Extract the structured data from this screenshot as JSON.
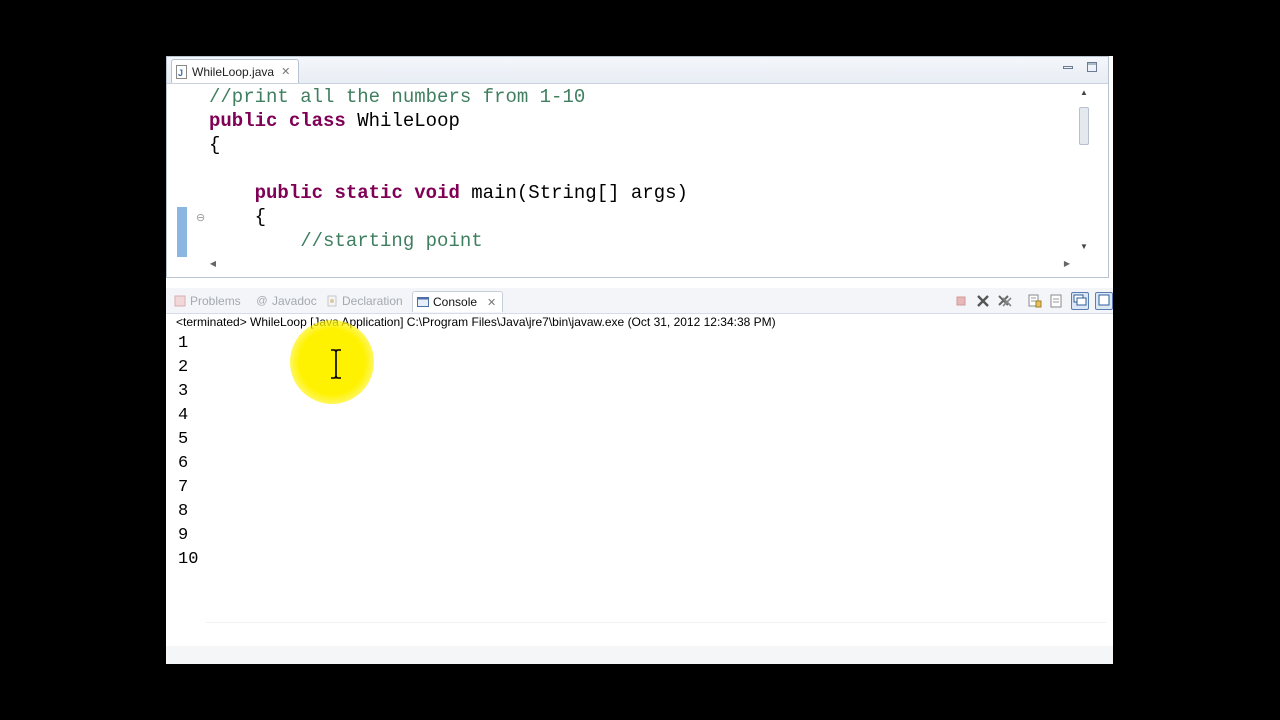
{
  "editor": {
    "tab_title": "WhileLoop.java",
    "close_glyph": "✕",
    "minimize_glyph": "▭",
    "maximize_glyph": "□",
    "code": {
      "line1_comment": "//print all the numbers from 1-10",
      "line2_kw1": "public",
      "line2_kw2": "class",
      "line2_name": "WhileLoop",
      "line3": "{",
      "line5_kw1": "public",
      "line5_kw2": "static",
      "line5_kw3": "void",
      "line5_rest": "main(String[] args)",
      "line6": "{",
      "line7_comment": "//starting point"
    }
  },
  "views": {
    "tabs": {
      "problems": "Problems",
      "javadoc": "Javadoc",
      "declaration": "Declaration",
      "console": "Console"
    },
    "console_close_glyph": "✕",
    "status": "<terminated> WhileLoop [Java Application] C:\\Program Files\\Java\\jre7\\bin\\javaw.exe (Oct 31, 2012 12:34:38 PM)",
    "output": [
      "1",
      "2",
      "3",
      "4",
      "5",
      "6",
      "7",
      "8",
      "9",
      "10"
    ]
  },
  "colors": {
    "keyword": "#7f0055",
    "comment": "#3f7f5f",
    "cursor_highlight": "#fff200"
  },
  "icons": [
    "java-file-icon",
    "close-icon",
    "minimize-icon",
    "maximize-icon",
    "problems-icon",
    "javadoc-icon",
    "declaration-icon",
    "console-icon",
    "terminate-icon",
    "remove-launch-icon",
    "remove-all-icon",
    "scroll-lock-icon",
    "pin-icon",
    "display-console-icon",
    "ibeam-cursor-icon"
  ]
}
